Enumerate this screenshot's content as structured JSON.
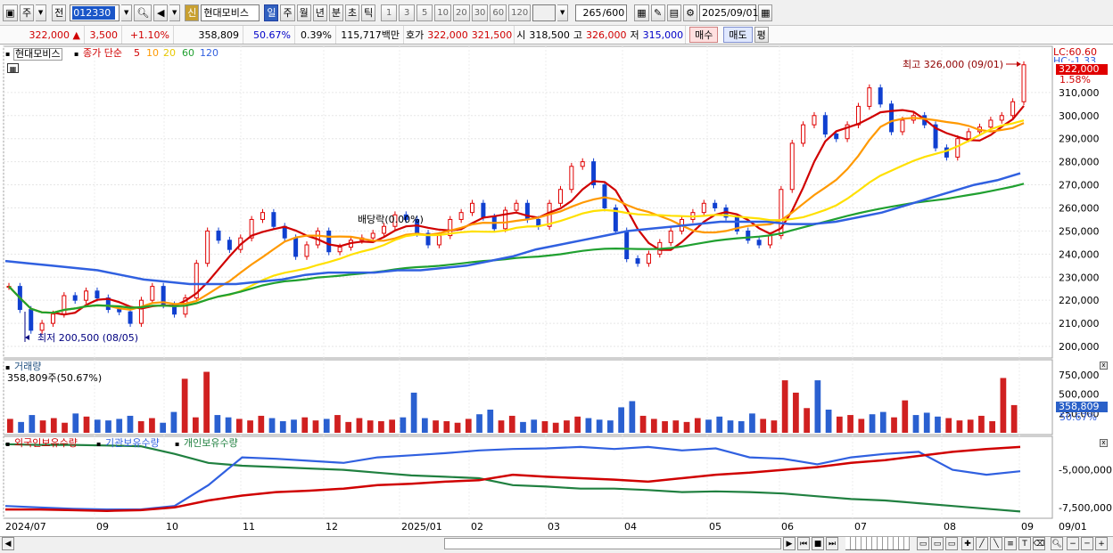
{
  "toolbar": {
    "type_label": "주",
    "prev_label": "전",
    "code": "012330",
    "new_badge": "신",
    "stock_name": "현대모비스",
    "periods": [
      "일",
      "주",
      "월",
      "년",
      "분",
      "초",
      "틱"
    ],
    "intervals": [
      "1",
      "3",
      "5",
      "10",
      "20",
      "30",
      "60",
      "120"
    ],
    "count": "265",
    "count_max": "/600",
    "date": "2025/09/01"
  },
  "quote": {
    "price": "322,000",
    "change": "3,500",
    "change_pct": "+1.10%",
    "volume": "358,809",
    "volume_ratio": "50.67%",
    "turnover": "0.39%",
    "amount": "115,717백만",
    "bid_label": "호가",
    "bid1": "322,000",
    "bid2": "321,500",
    "open_label": "시",
    "open": "318,500",
    "high_label": "고",
    "high": "326,000",
    "low_label": "저",
    "low": "315,000",
    "buy_label": "매수",
    "sell_label": "매도",
    "eval_label": "평"
  },
  "price_panel": {
    "name": "현대모비스",
    "ma_label": "종가 단순",
    "ma_periods": [
      "5",
      "10",
      "20",
      "60",
      "120"
    ],
    "ma_colors": [
      "#d00000",
      "#ff9900",
      "#ffe000",
      "#20a030",
      "#3060e0"
    ],
    "high_note": "최고 326,000 (09/01)",
    "low_note": "최저 200,500 (08/05)",
    "dividend_note": "배당락(0.00%)",
    "lc_label": "LC:60.60",
    "hc_label": "HC:-1.33",
    "last_price_tag": "322,000",
    "last_pct": "1.58%"
  },
  "volume_panel": {
    "title": "거래량",
    "value_text": "358,809주(50.67%)",
    "tag": "358,809",
    "tag_pct": "50.67%"
  },
  "holding_panel": {
    "legend": [
      "외국인보유수량",
      "기관보유수량",
      "개인보유수량"
    ],
    "colors": [
      "#d00000",
      "#3060e0",
      "#208040"
    ]
  },
  "chart_data": {
    "type": "line",
    "title": "현대모비스",
    "price_axis": {
      "ticks": [
        "310,000",
        "300,000",
        "290,000",
        "280,000",
        "270,000",
        "260,000",
        "250,000",
        "240,000",
        "230,000",
        "220,000",
        "210,000",
        "200,000"
      ],
      "ylim": [
        195000,
        330000
      ]
    },
    "volume_axis": {
      "ticks": [
        "750,000",
        "500,000",
        "250,000"
      ]
    },
    "holding_axis": {
      "ticks": [
        "-5,000,000",
        "-7,500,000"
      ]
    },
    "x_ticks": [
      "2024/07",
      "09",
      "10",
      "11",
      "12",
      "2025/01",
      "02",
      "03",
      "04",
      "05",
      "06",
      "07",
      "08",
      "09",
      "09/01"
    ],
    "series": [
      {
        "name": "종가",
        "values": [
          226000,
          216000,
          207000,
          210000,
          214000,
          222000,
          220000,
          224000,
          221000,
          216000,
          215000,
          210000,
          220000,
          226000,
          218000,
          214000,
          221000,
          236000,
          250000,
          246000,
          242000,
          247000,
          255000,
          258000,
          252000,
          247000,
          239000,
          244000,
          250000,
          241000,
          243000,
          246000,
          247000,
          249000,
          252000,
          257000,
          255000,
          249000,
          244000,
          248000,
          255000,
          258000,
          262000,
          256000,
          251000,
          259000,
          262000,
          255000,
          252000,
          262000,
          268000,
          278000,
          280000,
          270000,
          260000,
          250000,
          238000,
          236000,
          240000,
          245000,
          250000,
          255000,
          258000,
          262000,
          260000,
          256000,
          250000,
          246000,
          244000,
          248000,
          268000,
          288000,
          296000,
          300000,
          292000,
          290000,
          296000,
          304000,
          312000,
          305000,
          293000,
          298000,
          300000,
          296000,
          286000,
          282000,
          290000,
          293000,
          295000,
          298000,
          300000,
          306000,
          322000
        ]
      },
      {
        "name": "120",
        "values": [
          237000,
          236000,
          235000,
          234000,
          233000,
          231000,
          229000,
          228000,
          227000,
          227000,
          227000,
          228000,
          229000,
          231000,
          232000,
          232000,
          232000,
          233000,
          233000,
          234000,
          235000,
          237000,
          239000,
          242000,
          244000,
          246000,
          248000,
          250000,
          251000,
          252000,
          253000,
          254000,
          254000,
          254000,
          253000,
          253000,
          254000,
          256000,
          258000,
          261000,
          264000,
          267000,
          270000,
          272000,
          275000
        ]
      }
    ],
    "volume_values": [
      180000,
      140000,
      230000,
      160000,
      190000,
      130000,
      250000,
      210000,
      170000,
      160000,
      180000,
      220000,
      150000,
      190000,
      130000,
      270000,
      700000,
      200000,
      790000,
      230000,
      200000,
      180000,
      160000,
      220000,
      190000,
      150000,
      170000,
      200000,
      160000,
      180000,
      230000,
      140000,
      190000,
      160000,
      150000,
      170000,
      200000,
      520000,
      190000,
      160000,
      150000,
      130000,
      180000,
      240000,
      300000,
      160000,
      220000,
      140000,
      170000,
      150000,
      130000,
      160000,
      210000,
      190000,
      170000,
      160000,
      330000,
      410000,
      220000,
      180000,
      150000,
      160000,
      140000,
      190000,
      170000,
      210000,
      160000,
      150000,
      250000,
      180000,
      160000,
      680000,
      520000,
      320000,
      680000,
      300000,
      210000,
      230000,
      180000,
      240000,
      270000,
      200000,
      420000,
      230000,
      260000,
      210000,
      190000,
      160000,
      170000,
      220000,
      150000,
      710000,
      358809
    ]
  }
}
